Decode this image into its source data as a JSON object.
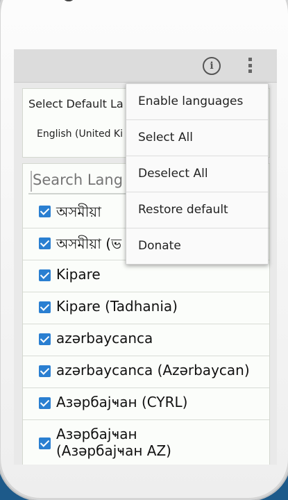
{
  "app": {
    "info_icon": "info-icon",
    "overflow_icon": "overflow-menu-icon"
  },
  "default_language": {
    "title": "Select Default La",
    "value": "English (United Ki"
  },
  "search": {
    "placeholder": "Search Lang"
  },
  "languages": [
    {
      "label": "অসমীয়া",
      "checked": true
    },
    {
      "label": "অসমীয়া (ভ",
      "checked": true
    },
    {
      "label": "Kipare",
      "checked": true
    },
    {
      "label": "Kipare (Tadhania)",
      "checked": true
    },
    {
      "label": "azərbaycanca",
      "checked": true
    },
    {
      "label": "azərbaycanca (Azərbaycan)",
      "checked": true
    },
    {
      "label": "Азәрбајҹан (CYRL)",
      "checked": true
    },
    {
      "label": "Азәрбајҹан",
      "label_line2": "(Азәрбајҹан AZ)",
      "checked": true
    }
  ],
  "menu": {
    "items": [
      "Enable languages",
      "Select All",
      "Deselect All",
      "Restore default",
      "Donate"
    ]
  },
  "colors": {
    "checkbox": "#2a7fd1",
    "background": "#1d5a8a"
  }
}
